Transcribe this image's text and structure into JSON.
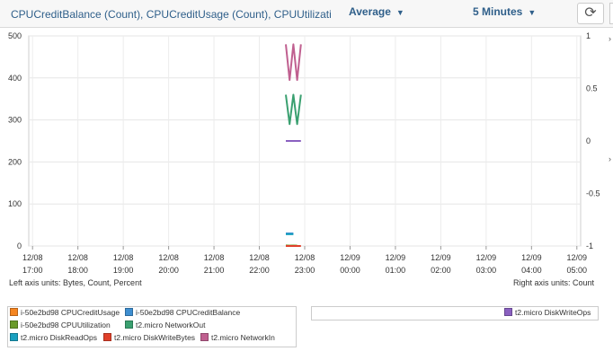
{
  "header": {
    "title": "CPUCreditBalance (Count), CPUCreditUsage (Count), CPUUtilization (",
    "statistic": "Average",
    "period": "5 Minutes"
  },
  "chart_data": {
    "type": "line",
    "x_ticks": [
      "12/08 17:00",
      "12/08 18:00",
      "12/08 19:00",
      "12/08 20:00",
      "12/08 21:00",
      "12/08 22:00",
      "12/08 23:00",
      "12/09 00:00",
      "12/09 01:00",
      "12/09 02:00",
      "12/09 03:00",
      "12/09 04:00",
      "12/09 05:00"
    ],
    "xlim": [
      "12/08 16:55",
      "12/09 05:05"
    ],
    "left_axis": {
      "ylim": [
        0,
        500
      ],
      "ticks": [
        0,
        100,
        200,
        300,
        400,
        500
      ]
    },
    "right_axis": {
      "ylim": [
        -1,
        1
      ],
      "ticks": [
        -1,
        -0.5,
        0,
        0.5,
        1
      ]
    },
    "left_units": "Left axis units:  Bytes, Count, Percent",
    "right_units": "Right axis units:  Count",
    "grid": true,
    "series": [
      {
        "name": "i-50e2bd98 CPUCreditUsage",
        "color": "#f58520",
        "axis": "left",
        "points": [
          [
            "12/08 22:35",
            0.6
          ],
          [
            "12/08 22:40",
            0.4
          ],
          [
            "12/08 22:45",
            0.5
          ],
          [
            "12/08 22:50",
            0.3
          ]
        ]
      },
      {
        "name": "i-50e2bd98 CPUCreditBalance",
        "color": "#3e8ed0",
        "axis": "left",
        "points": [
          [
            "12/08 22:35",
            30
          ],
          [
            "12/08 22:40",
            30
          ],
          [
            "12/08 22:45",
            30
          ]
        ]
      },
      {
        "name": "i-50e2bd98 CPUUtilization",
        "color": "#6a9a2a",
        "axis": "left",
        "points": [
          [
            "12/08 22:35",
            1.2
          ],
          [
            "12/08 22:40",
            0.8
          ],
          [
            "12/08 22:45",
            1.1
          ],
          [
            "12/08 22:50",
            0.9
          ]
        ]
      },
      {
        "name": "t2.micro NetworkOut",
        "color": "#3aa070",
        "axis": "left",
        "points": [
          [
            "12/08 22:35",
            360
          ],
          [
            "12/08 22:40",
            290
          ],
          [
            "12/08 22:45",
            360
          ],
          [
            "12/08 22:50",
            290
          ],
          [
            "12/08 22:55",
            360
          ]
        ]
      },
      {
        "name": "t2.micro DiskReadOps",
        "color": "#1aa0c0",
        "axis": "left",
        "points": [
          [
            "12/08 22:35",
            28
          ],
          [
            "12/08 22:40",
            28
          ],
          [
            "12/08 22:45",
            28
          ]
        ]
      },
      {
        "name": "t2.micro DiskWriteBytes",
        "color": "#e0402a",
        "axis": "left",
        "points": [
          [
            "12/08 22:35",
            0
          ],
          [
            "12/08 22:40",
            0
          ],
          [
            "12/08 22:45",
            0
          ],
          [
            "12/08 22:50",
            0
          ],
          [
            "12/08 22:55",
            0
          ]
        ]
      },
      {
        "name": "t2.micro NetworkIn",
        "color": "#c06090",
        "axis": "left",
        "points": [
          [
            "12/08 22:35",
            480
          ],
          [
            "12/08 22:40",
            395
          ],
          [
            "12/08 22:45",
            480
          ],
          [
            "12/08 22:50",
            395
          ],
          [
            "12/08 22:55",
            480
          ]
        ]
      },
      {
        "name": "t2.micro DiskWriteOps",
        "color": "#8a60c0",
        "axis": "right",
        "points": [
          [
            "12/08 22:35",
            0
          ],
          [
            "12/08 22:40",
            0
          ],
          [
            "12/08 22:45",
            0
          ],
          [
            "12/08 22:50",
            0
          ],
          [
            "12/08 22:55",
            0
          ]
        ]
      }
    ]
  },
  "legend_left": [
    {
      "label": "i-50e2bd98 CPUCreditUsage",
      "color": "#f58520"
    },
    {
      "label": "i-50e2bd98 CPUCreditBalance",
      "color": "#3e8ed0"
    },
    {
      "label": "i-50e2bd98 CPUUtilization",
      "color": "#6a9a2a"
    },
    {
      "label": "t2.micro NetworkOut",
      "color": "#3aa070"
    },
    {
      "label": "t2.micro DiskReadOps",
      "color": "#1aa0c0"
    },
    {
      "label": "t2.micro DiskWriteBytes",
      "color": "#e0402a"
    },
    {
      "label": "t2.micro NetworkIn",
      "color": "#c06090"
    }
  ],
  "legend_right": [
    {
      "label": "t2.micro DiskWriteOps",
      "color": "#8a60c0"
    }
  ],
  "icons": {
    "refresh": "refresh-icon",
    "dropdown": "chevron-down-icon"
  }
}
